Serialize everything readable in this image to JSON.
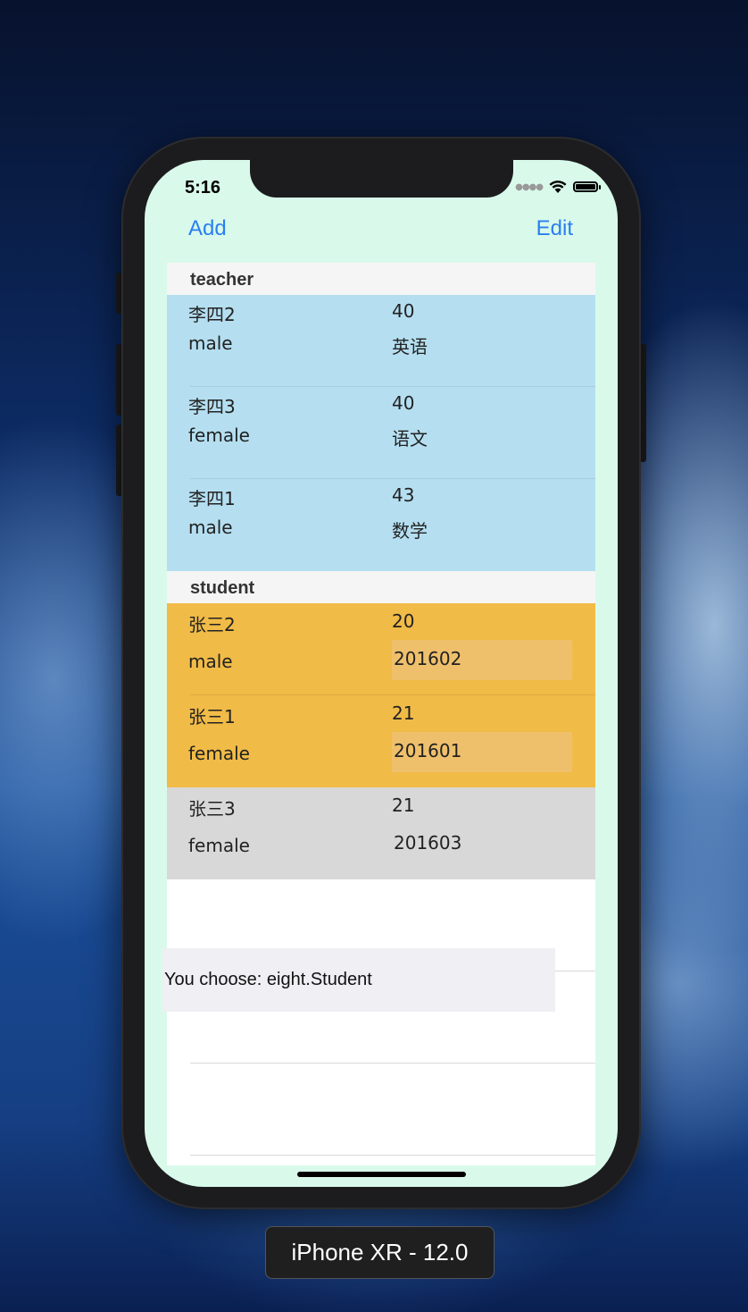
{
  "status_bar": {
    "time": "5:16",
    "signal_icon": "dots-signal-icon",
    "wifi_icon": "wifi-icon",
    "battery_icon": "battery-icon"
  },
  "nav": {
    "add_label": "Add",
    "edit_label": "Edit",
    "accent": "#2a7ff0"
  },
  "sections": [
    {
      "title": "teacher",
      "color": "#b5dff1",
      "rows": [
        {
          "name": "李四2",
          "age": "40",
          "gender": "male",
          "subject": "英语"
        },
        {
          "name": "李四3",
          "age": "40",
          "gender": "female",
          "subject": "语文"
        },
        {
          "name": "李四1",
          "age": "43",
          "gender": "male",
          "subject": "数学"
        }
      ]
    },
    {
      "title": "student",
      "color": "#f1bb47",
      "rows": [
        {
          "name": "张三2",
          "age": "20",
          "gender": "male",
          "id": "201602"
        },
        {
          "name": "张三1",
          "age": "21",
          "gender": "female",
          "id": "201601"
        },
        {
          "name": "张三3",
          "age": "21",
          "gender": "female",
          "id": "201603"
        }
      ]
    }
  ],
  "toast": {
    "text": "You choose: eight.Student"
  },
  "device": {
    "label": "iPhone XR - 12.0"
  }
}
